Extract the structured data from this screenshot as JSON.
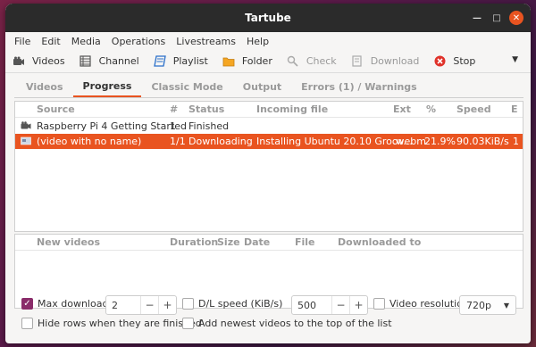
{
  "window": {
    "title": "Tartube"
  },
  "menu": [
    "File",
    "Edit",
    "Media",
    "Operations",
    "Livestreams",
    "Help"
  ],
  "toolbar": {
    "videos": "Videos",
    "channel": "Channel",
    "playlist": "Playlist",
    "folder": "Folder",
    "check": "Check",
    "download": "Download",
    "stop": "Stop"
  },
  "tabs": [
    "Videos",
    "Progress",
    "Classic Mode",
    "Output",
    "Errors (1) / Warnings"
  ],
  "progress_table": {
    "headers": {
      "source": "Source",
      "num": "#",
      "status": "Status",
      "incoming": "Incoming file",
      "ext": "Ext",
      "pct": "%",
      "speed": "Speed",
      "eta": "E"
    },
    "rows": [
      {
        "source": "Raspberry Pi 4 Getting Started",
        "num": "1",
        "status": "Finished",
        "incoming": "",
        "ext": "",
        "pct": "",
        "speed": "",
        "eta": ""
      },
      {
        "source": "(video with no name)",
        "num": "1/1",
        "status": "Downloading",
        "incoming": "Installing Ubuntu 20.10 Groov...",
        "ext": ".webm",
        "pct": "21.9%",
        "speed": "90.03KiB/s",
        "eta": "1"
      }
    ]
  },
  "new_videos_table": {
    "headers": {
      "new_videos": "New videos",
      "duration": "Duration",
      "size": "Size",
      "date": "Date",
      "file": "File",
      "downloaded_to": "Downloaded to"
    }
  },
  "options": {
    "max_downloads_label": "Max downloads",
    "max_downloads_value": "2",
    "dl_speed_label": "D/L speed (KiB/s)",
    "dl_speed_value": "500",
    "video_resolution_label": "Video resolution",
    "video_resolution_value": "720p",
    "hide_rows_label": "Hide rows when they are finished",
    "add_newest_label": "Add newest videos to the top of the list",
    "plus": "+",
    "minus": "−"
  },
  "colors": {
    "accent": "#e95420",
    "checkbox": "#8a2c6a",
    "titlebar": "#2b2b2b"
  }
}
